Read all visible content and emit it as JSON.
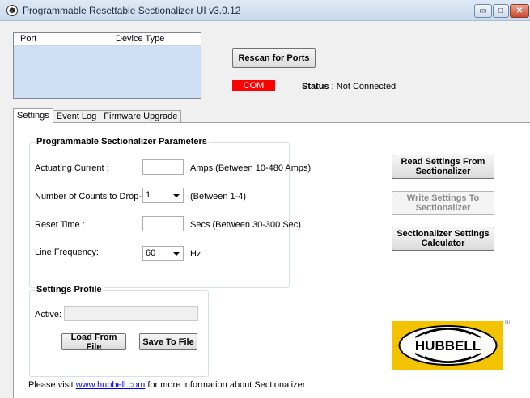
{
  "window": {
    "title": "Programmable Resettable Sectionalizer UI v3.0.12",
    "icon": "hubbell-app-icon",
    "controls": {
      "minimize": "▭",
      "maximize": "□",
      "close": "✕"
    }
  },
  "ports": {
    "columns": [
      "Port",
      "Device Type"
    ],
    "rows": []
  },
  "rescan_label": "Rescan for Ports",
  "com": {
    "label": "COM",
    "color": "#ff0000"
  },
  "status": {
    "label": "Status",
    "separator": " : ",
    "value": "Not Connected"
  },
  "tabs": [
    {
      "label": "Settings",
      "active": true
    },
    {
      "label": "Event Log",
      "active": false
    },
    {
      "label": "Firmware Upgrade",
      "active": false
    }
  ],
  "params": {
    "title": "Programmable Sectionalizer Parameters",
    "actuating": {
      "label": "Actuating Current :",
      "value": "",
      "hint": "Amps (Between 10-480 Amps)"
    },
    "counts": {
      "label": "Number of Counts to Drop-Out :",
      "value": "1",
      "hint": "(Between 1-4)"
    },
    "reset": {
      "label": "Reset Time :",
      "value": "",
      "hint": "Secs  (Between 30-300 Sec)"
    },
    "frequency": {
      "label": "Line Frequency:",
      "value": "60",
      "hint": "Hz"
    }
  },
  "actions": {
    "read_label": "Read Settings From Sectionalizer",
    "write_label": "Write Settings To Sectionalizer",
    "calculator_label": "Sectionalizer Settings Calculator"
  },
  "profile": {
    "title": "Settings Profile",
    "active_label": "Active:",
    "active_value": "",
    "load_label": "Load From File",
    "save_label": "Save To File"
  },
  "logo": {
    "text": "HUBBELL",
    "reg": "®",
    "bg_color": "#f3c300"
  },
  "footer": {
    "prefix": "Please visit ",
    "link": "www.hubbell.com",
    "suffix": " for more information about Sectionalizer"
  }
}
